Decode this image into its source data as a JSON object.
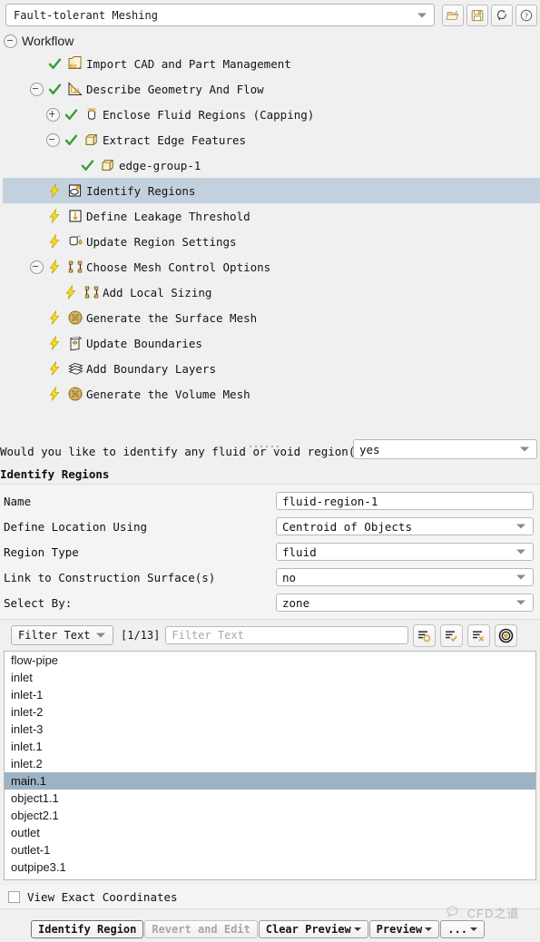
{
  "topbar": {
    "workflow_name": "Fault-tolerant Meshing",
    "buttons": [
      {
        "name": "open-workflow-button",
        "icon": "open-folder-icon",
        "title": "Open"
      },
      {
        "name": "save-workflow-button",
        "icon": "floppy-save-icon",
        "title": "Save"
      },
      {
        "name": "reset-workflow-button",
        "icon": "refresh-arrows-icon",
        "title": "Reset"
      },
      {
        "name": "help-button",
        "icon": "question-help-icon",
        "title": "Help"
      }
    ]
  },
  "tree": {
    "root_label": "Workflow",
    "items": [
      {
        "label": "Import CAD and Part Management",
        "indent": 1,
        "expander": "none",
        "state": "done",
        "icon": "cad-box-icon"
      },
      {
        "label": "Describe Geometry And Flow",
        "indent": 1,
        "expander": "minus",
        "state": "done",
        "icon": "triangle-ruler-icon"
      },
      {
        "label": "Enclose Fluid Regions (Capping)",
        "indent": 2,
        "expander": "plus",
        "state": "done",
        "icon": "capping-cylinder-icon"
      },
      {
        "label": "Extract Edge Features",
        "indent": 2,
        "expander": "minus",
        "state": "done",
        "icon": "edge-cube-icon"
      },
      {
        "label": "edge-group-1",
        "indent": 3,
        "expander": "none",
        "state": "done",
        "icon": "edge-cube-icon"
      },
      {
        "label": "Identify Regions",
        "indent": 1,
        "expander": "none",
        "state": "pending",
        "icon": "region-oval-icon",
        "selected": true
      },
      {
        "label": "Define Leakage Threshold",
        "indent": 1,
        "expander": "none",
        "state": "pending",
        "icon": "down-arrow-box-icon"
      },
      {
        "label": "Update Region Settings",
        "indent": 1,
        "expander": "none",
        "state": "pending",
        "icon": "region-droplet-icon"
      },
      {
        "label": "Choose Mesh Control Options",
        "indent": 1,
        "expander": "minus",
        "state": "pending",
        "icon": "mesh-control-icon"
      },
      {
        "label": "Add Local Sizing",
        "indent": 2,
        "expander": "none",
        "state": "pending",
        "icon": "local-sizing-icon"
      },
      {
        "label": "Generate the Surface Mesh",
        "indent": 1,
        "expander": "none",
        "state": "pending",
        "icon": "surface-mesh-sphere-icon"
      },
      {
        "label": "Update Boundaries",
        "indent": 1,
        "expander": "none",
        "state": "pending",
        "icon": "boundaries-icon"
      },
      {
        "label": "Add Boundary Layers",
        "indent": 1,
        "expander": "none",
        "state": "pending",
        "icon": "boundary-layers-icon"
      },
      {
        "label": "Generate the Volume Mesh",
        "indent": 1,
        "expander": "none",
        "state": "pending",
        "icon": "volume-mesh-sphere-icon"
      }
    ]
  },
  "question": {
    "text": "Would you like to identify any fluid or void region(s)?",
    "value": "yes"
  },
  "panel": {
    "title": "Identify Regions",
    "fields": [
      {
        "label": "Name",
        "value": "fluid-region-1",
        "type": "text"
      },
      {
        "label": "Define Location Using",
        "value": "Centroid of Objects",
        "type": "select"
      },
      {
        "label": "Region Type",
        "value": "fluid",
        "type": "select"
      },
      {
        "label": "Link to Construction Surface(s)",
        "value": "no",
        "type": "select"
      },
      {
        "label": "Select By:",
        "value": "zone",
        "type": "select"
      }
    ]
  },
  "filter_toolbar": {
    "mode_value": "Filter Text",
    "counter": "[1/13]",
    "search_placeholder": "Filter Text",
    "buttons": [
      {
        "name": "list-selection-button",
        "icon": "list-circle-icon"
      },
      {
        "name": "select-all-button",
        "icon": "list-check-icon"
      },
      {
        "name": "deselect-all-button",
        "icon": "list-x-icon"
      },
      {
        "name": "selection-target-button",
        "icon": "bullseye-target-icon"
      }
    ]
  },
  "zone_list": {
    "items": [
      {
        "label": "flow-pipe",
        "selected": false
      },
      {
        "label": "inlet",
        "selected": false
      },
      {
        "label": "inlet-1",
        "selected": false
      },
      {
        "label": "inlet-2",
        "selected": false
      },
      {
        "label": "inlet-3",
        "selected": false
      },
      {
        "label": "inlet.1",
        "selected": false
      },
      {
        "label": "inlet.2",
        "selected": false
      },
      {
        "label": "main.1",
        "selected": true
      },
      {
        "label": "object1.1",
        "selected": false
      },
      {
        "label": "object2.1",
        "selected": false
      },
      {
        "label": "outlet",
        "selected": false
      },
      {
        "label": "outlet-1",
        "selected": false
      },
      {
        "label": "outpipe3.1",
        "selected": false
      }
    ]
  },
  "view_exact": {
    "label": "View Exact Coordinates",
    "checked": false
  },
  "actions": [
    {
      "label": "Identify Region",
      "state": "focus",
      "dropdown": false
    },
    {
      "label": "Revert and Edit",
      "state": "disabled",
      "dropdown": false
    },
    {
      "label": "Clear Preview",
      "state": "normal",
      "dropdown": true
    },
    {
      "label": "Preview",
      "state": "normal",
      "dropdown": true
    },
    {
      "label": "...",
      "state": "normal",
      "dropdown": true
    }
  ],
  "watermark": {
    "text": "CFD之道"
  },
  "colors": {
    "selection_tree": "#c3d1de",
    "selection_list": "#9db2c4",
    "done_check": "#3a9e3a",
    "pending_bolt": "#f4d520",
    "panel_bg": "#f0f0f0"
  }
}
